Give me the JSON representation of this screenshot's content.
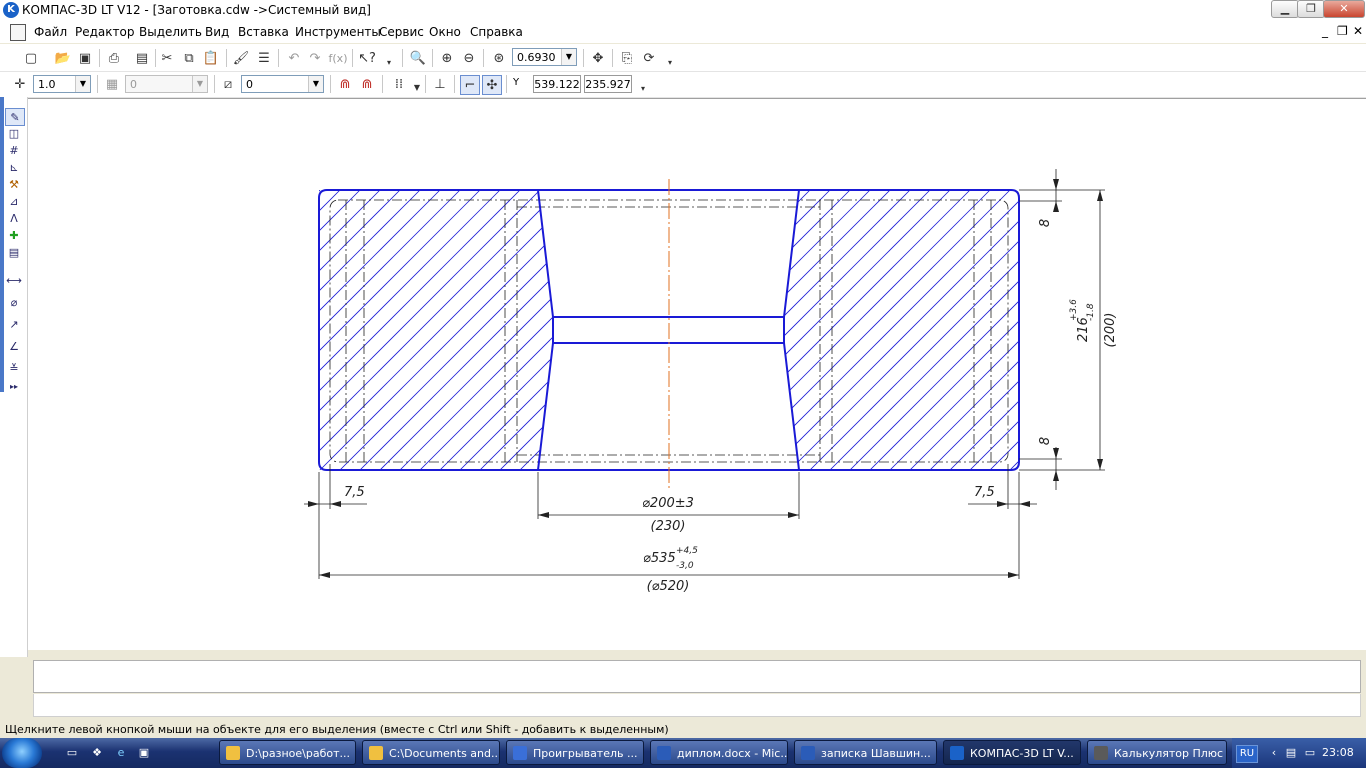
{
  "window": {
    "title": "КОМПАС-3D LT V12 - [Заготовка.cdw ->Системный вид]",
    "app_icon_letter": "K",
    "min": "▁",
    "restore": "❐",
    "close": "✕"
  },
  "menu": {
    "items": [
      "Файл",
      "Редактор",
      "Выделить",
      "Вид",
      "Вставка",
      "Инструменты",
      "Сервис",
      "Окно",
      "Справка"
    ],
    "mdi_min": "_",
    "mdi_restore": "❐",
    "mdi_close": "✕"
  },
  "toolbar1": {
    "zoom_value": "0.6930"
  },
  "toolbar2": {
    "step_value": "1.0",
    "layer_value": "0",
    "style_value": "0",
    "coord_label": "Y",
    "coord_x": "539.122",
    "coord_y": "235.927"
  },
  "drawing": {
    "dim_top_gap": "8",
    "dim_bottom_gap": "8",
    "dim_height_main": "216",
    "dim_height_sup": "+3.6",
    "dim_height_sub": "-1.8",
    "dim_height_ref": "(200)",
    "dim_left_offset": "7,5",
    "dim_right_offset": "7,5",
    "dim_bore": "⌀200±3",
    "dim_bore_ref": "(230)",
    "dim_outer": "⌀535",
    "dim_outer_sup": "+4,5",
    "dim_outer_sub": "-3,0",
    "dim_outer_ref": "(⌀520)",
    "colors": {
      "contour": "#1a1ad6",
      "axis": "#e07020",
      "dim": "#222222",
      "hatch": "#1a1ad6"
    }
  },
  "status": {
    "hint": "Щелкните левой кнопкой мыши на объекте для его выделения (вместе с Ctrl или Shift - добавить к выделенным)"
  },
  "taskbar": {
    "tasks": [
      {
        "label": "D:\\разное\\работ...",
        "icon_color": "#f0c040"
      },
      {
        "label": "C:\\Documents and...",
        "icon_color": "#f0c040"
      },
      {
        "label": "Проигрыватель ...",
        "icon_color": "#3a6fd8"
      },
      {
        "label": "диплом.docx - Mic...",
        "icon_color": "#2b5cb8"
      },
      {
        "label": "записка Шавшин...",
        "icon_color": "#2b5cb8"
      },
      {
        "label": "КОМПАС-3D LT V...",
        "icon_color": "#1a62c8"
      },
      {
        "label": "Калькулятор Плюс",
        "icon_color": "#5a5a5a"
      }
    ],
    "lang": "RU",
    "clock": "23:08"
  }
}
